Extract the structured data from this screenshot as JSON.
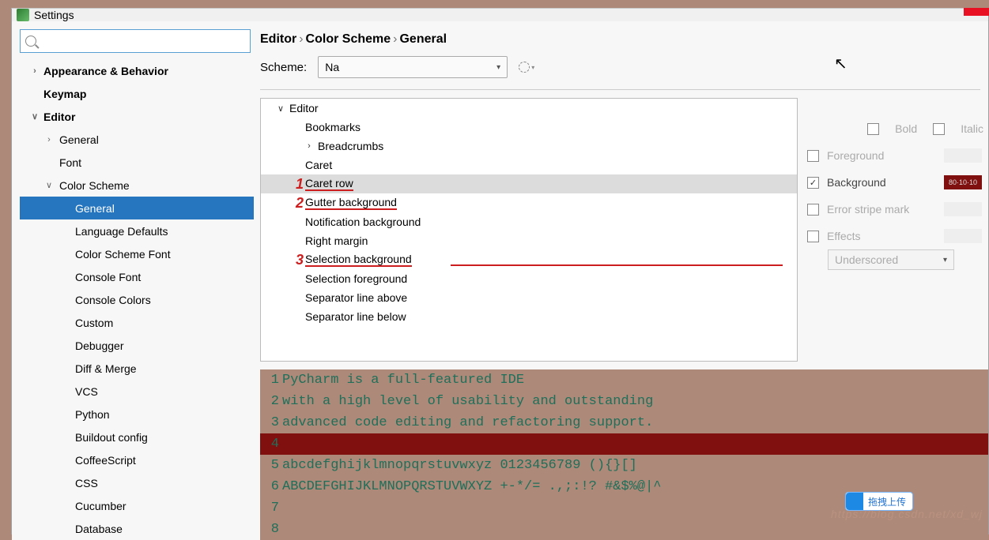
{
  "window": {
    "title": "Settings"
  },
  "sidebar": {
    "search": {
      "value": ""
    },
    "nodes": [
      {
        "label": "Appearance & Behavior",
        "bold": true,
        "depth": 0,
        "arrow": "›"
      },
      {
        "label": "Keymap",
        "bold": true,
        "depth": 0
      },
      {
        "label": "Editor",
        "bold": true,
        "depth": 0,
        "arrow": "∨"
      },
      {
        "label": "General",
        "depth": 1,
        "arrow": "›"
      },
      {
        "label": "Font",
        "depth": 1
      },
      {
        "label": "Color Scheme",
        "depth": 1,
        "arrow": "∨"
      },
      {
        "label": "General",
        "depth": 2,
        "selected": true
      },
      {
        "label": "Language Defaults",
        "depth": 2
      },
      {
        "label": "Color Scheme Font",
        "depth": 2
      },
      {
        "label": "Console Font",
        "depth": 2
      },
      {
        "label": "Console Colors",
        "depth": 2
      },
      {
        "label": "Custom",
        "depth": 2
      },
      {
        "label": "Debugger",
        "depth": 2
      },
      {
        "label": "Diff & Merge",
        "depth": 2
      },
      {
        "label": "VCS",
        "depth": 2
      },
      {
        "label": "Python",
        "depth": 2
      },
      {
        "label": "Buildout config",
        "depth": 2
      },
      {
        "label": "CoffeeScript",
        "depth": 2
      },
      {
        "label": "CSS",
        "depth": 2
      },
      {
        "label": "Cucumber",
        "depth": 2
      },
      {
        "label": "Database",
        "depth": 2
      }
    ]
  },
  "breadcrumb": {
    "p0": "Editor",
    "p1": "Color Scheme",
    "p2": "General"
  },
  "scheme": {
    "label": "Scheme:",
    "value": "Na"
  },
  "attrTree": [
    {
      "label": "Editor",
      "depth": 0,
      "arrow": "∨"
    },
    {
      "label": "Bookmarks",
      "depth": 1
    },
    {
      "label": "Breadcrumbs",
      "depth": 1,
      "arrow": "›"
    },
    {
      "label": "Caret",
      "depth": 1
    },
    {
      "label": "Caret row",
      "depth": 1,
      "selected": true,
      "red": "1"
    },
    {
      "label": "Gutter background",
      "depth": 1,
      "red": "2"
    },
    {
      "label": "Notification background",
      "depth": 1
    },
    {
      "label": "Right margin",
      "depth": 1
    },
    {
      "label": "Selection background",
      "depth": 1,
      "red": "3",
      "tail": true
    },
    {
      "label": "Selection foreground",
      "depth": 1
    },
    {
      "label": "Separator line above",
      "depth": 1
    },
    {
      "label": "Separator line below",
      "depth": 1
    }
  ],
  "props": {
    "bold": "Bold",
    "italic": "Italic",
    "foreground": "Foreground",
    "background": "Background",
    "bg_checked": true,
    "bg_color": "#801010",
    "bg_text": "80·10·10",
    "errorstripe": "Error stripe mark",
    "effects": "Effects",
    "effects_value": "Underscored"
  },
  "preview": {
    "lines": [
      {
        "n": "1",
        "t": "PyCharm is a full-featured IDE"
      },
      {
        "n": "2",
        "t": "with a high level of usability and outstanding"
      },
      {
        "n": "3",
        "t": "advanced code editing and refactoring support."
      },
      {
        "n": "4",
        "t": "",
        "caret": true
      },
      {
        "n": "5",
        "t": "abcdefghijklmnopqrstuvwxyz 0123456789 (){}[]"
      },
      {
        "n": "6",
        "t": "ABCDEFGHIJKLMNOPQRSTUVWXYZ +-*/= .,;:!? #&$%@|^"
      },
      {
        "n": "7",
        "t": ""
      },
      {
        "n": "8",
        "t": ""
      }
    ]
  },
  "upload": {
    "label": "拖拽上传"
  },
  "watermark": "https://blog.csdn.net/xd_wj"
}
